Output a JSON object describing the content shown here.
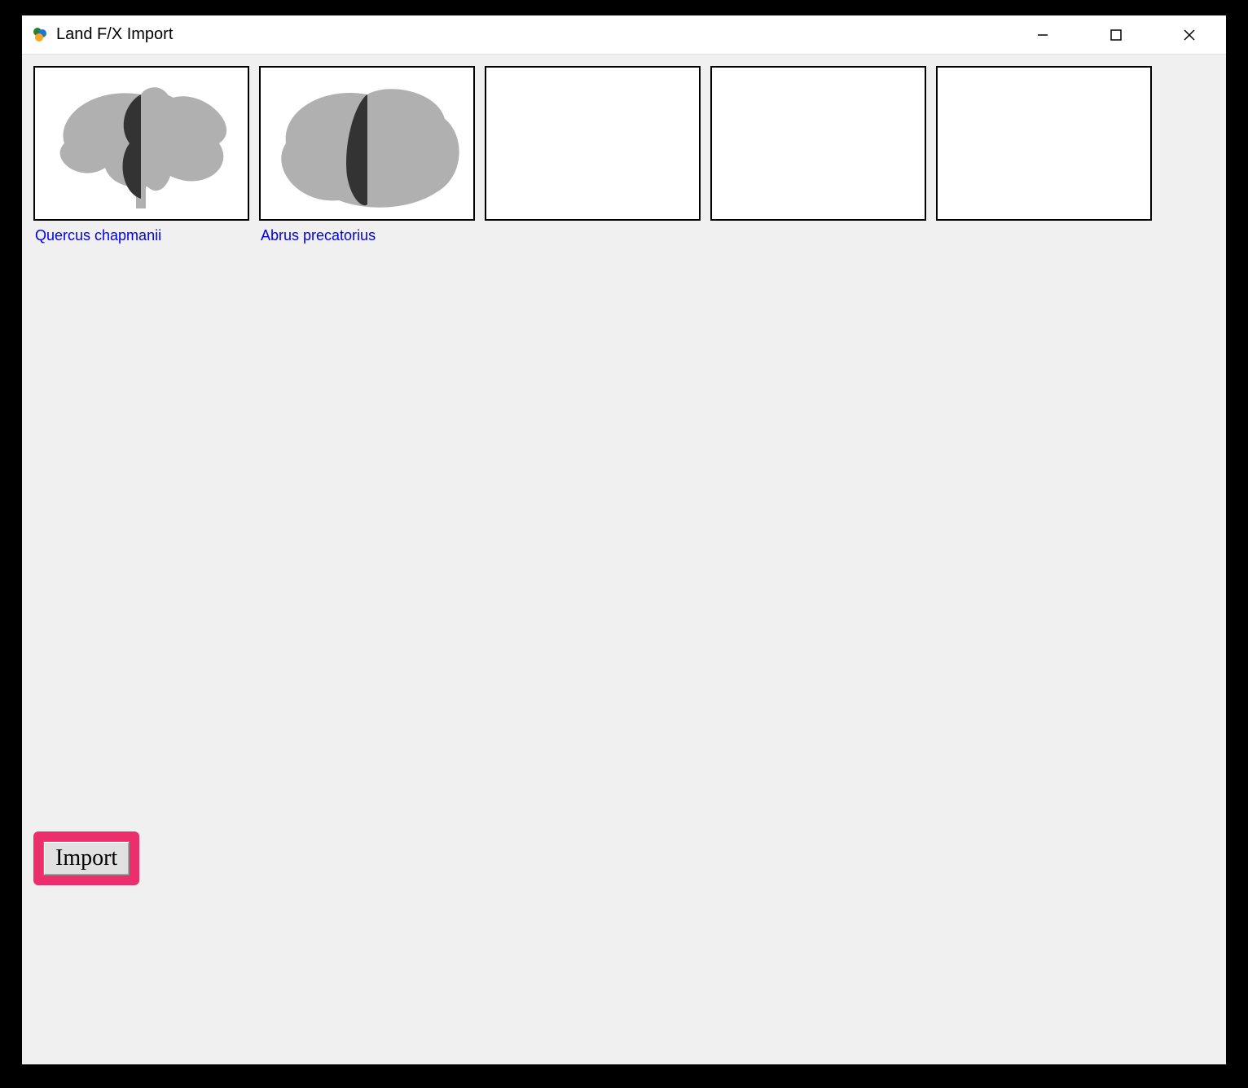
{
  "window": {
    "title": "Land F/X Import",
    "icon": "app-icon"
  },
  "thumbnails": [
    {
      "label": "Quercus chapmanii",
      "image": "tree-tall"
    },
    {
      "label": "Abrus precatorius",
      "image": "tree-bush"
    },
    {
      "label": "",
      "image": ""
    },
    {
      "label": "",
      "image": ""
    },
    {
      "label": "",
      "image": ""
    }
  ],
  "buttons": {
    "import": "Import"
  },
  "highlight_color": "#ed2e6c"
}
